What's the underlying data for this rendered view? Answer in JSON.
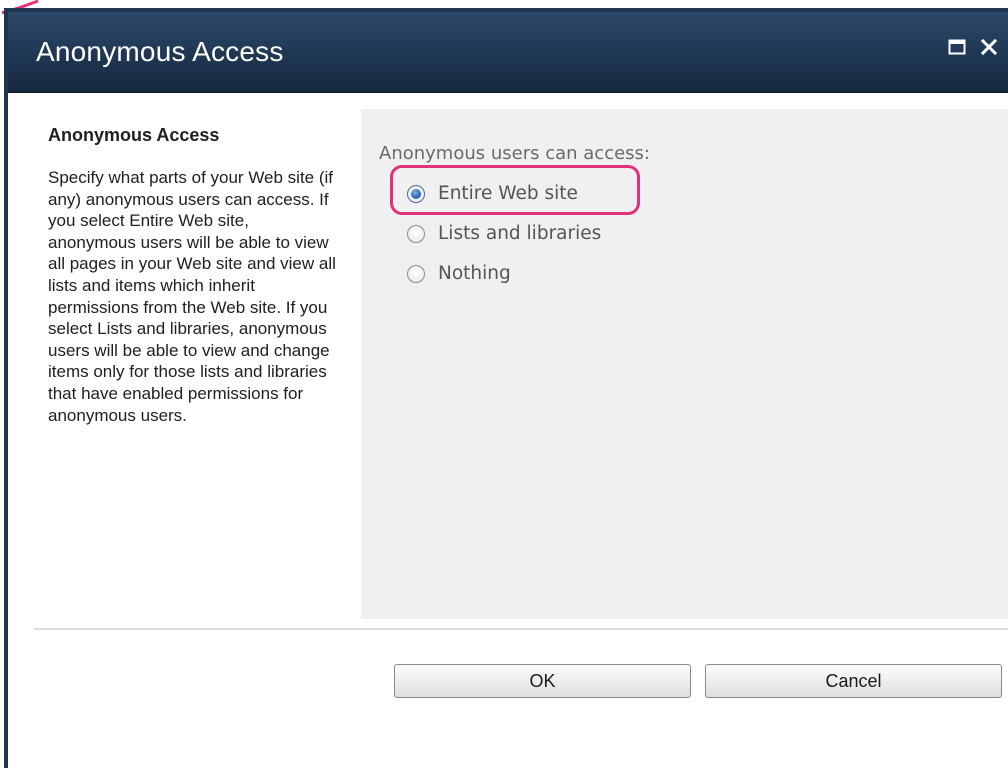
{
  "dialog": {
    "title": "Anonymous Access"
  },
  "section": {
    "title": "Anonymous Access",
    "description": "Specify what parts of your Web site (if any) anonymous users can access. If you select Entire Web site, anonymous users will be able to view all pages in your Web site and view all lists and items which inherit permissions from the Web site. If you select Lists and libraries, anonymous users will be able to view and change items only for those lists and libraries that have enabled permissions for anonymous users."
  },
  "access": {
    "label": "Anonymous users can access:",
    "options": [
      {
        "label": "Entire Web site",
        "checked": true
      },
      {
        "label": "Lists and libraries",
        "checked": false
      },
      {
        "label": "Nothing",
        "checked": false
      }
    ]
  },
  "buttons": {
    "ok": "OK",
    "cancel": "Cancel"
  },
  "colors": {
    "title_bar": "#213a57",
    "highlight": "#e3307a"
  },
  "icons": [
    "maximize-icon",
    "close-icon"
  ]
}
